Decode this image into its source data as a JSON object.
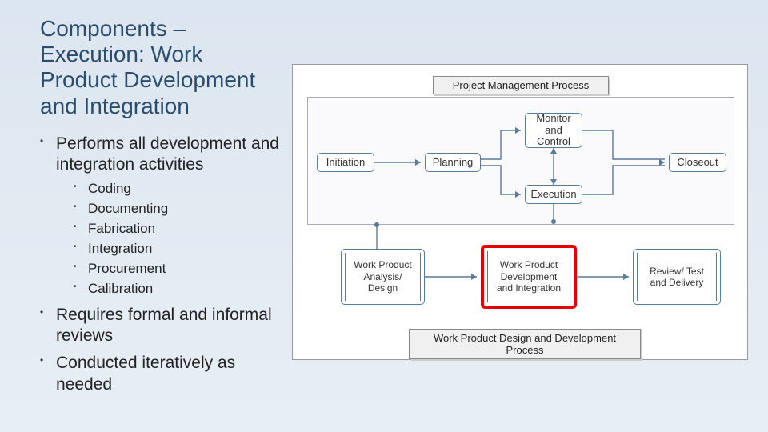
{
  "title": "Components – Execution: Work Product Development and Integration",
  "bullets": {
    "b1": "Performs all development and integration activities",
    "b2": "Requires formal and informal reviews",
    "b3": "Conducted iteratively as needed"
  },
  "sub": {
    "s1": "Coding",
    "s2": "Documenting",
    "s3": "Fabrication",
    "s4": "Integration",
    "s5": "Procurement",
    "s6": "Calibration"
  },
  "diagram": {
    "topLabel": "Project Management Process",
    "bottomLabel": "Work Product Design and Development Process",
    "phases": {
      "initiation": "Initiation",
      "planning": "Planning",
      "monitor": "Monitor and Control",
      "execution": "Execution",
      "closeout": "Closeout"
    },
    "sub": {
      "analysis": "Work Product Analysis/ Design",
      "dev": "Work Product Development and Integration",
      "review": "Review/ Test and Delivery"
    }
  }
}
